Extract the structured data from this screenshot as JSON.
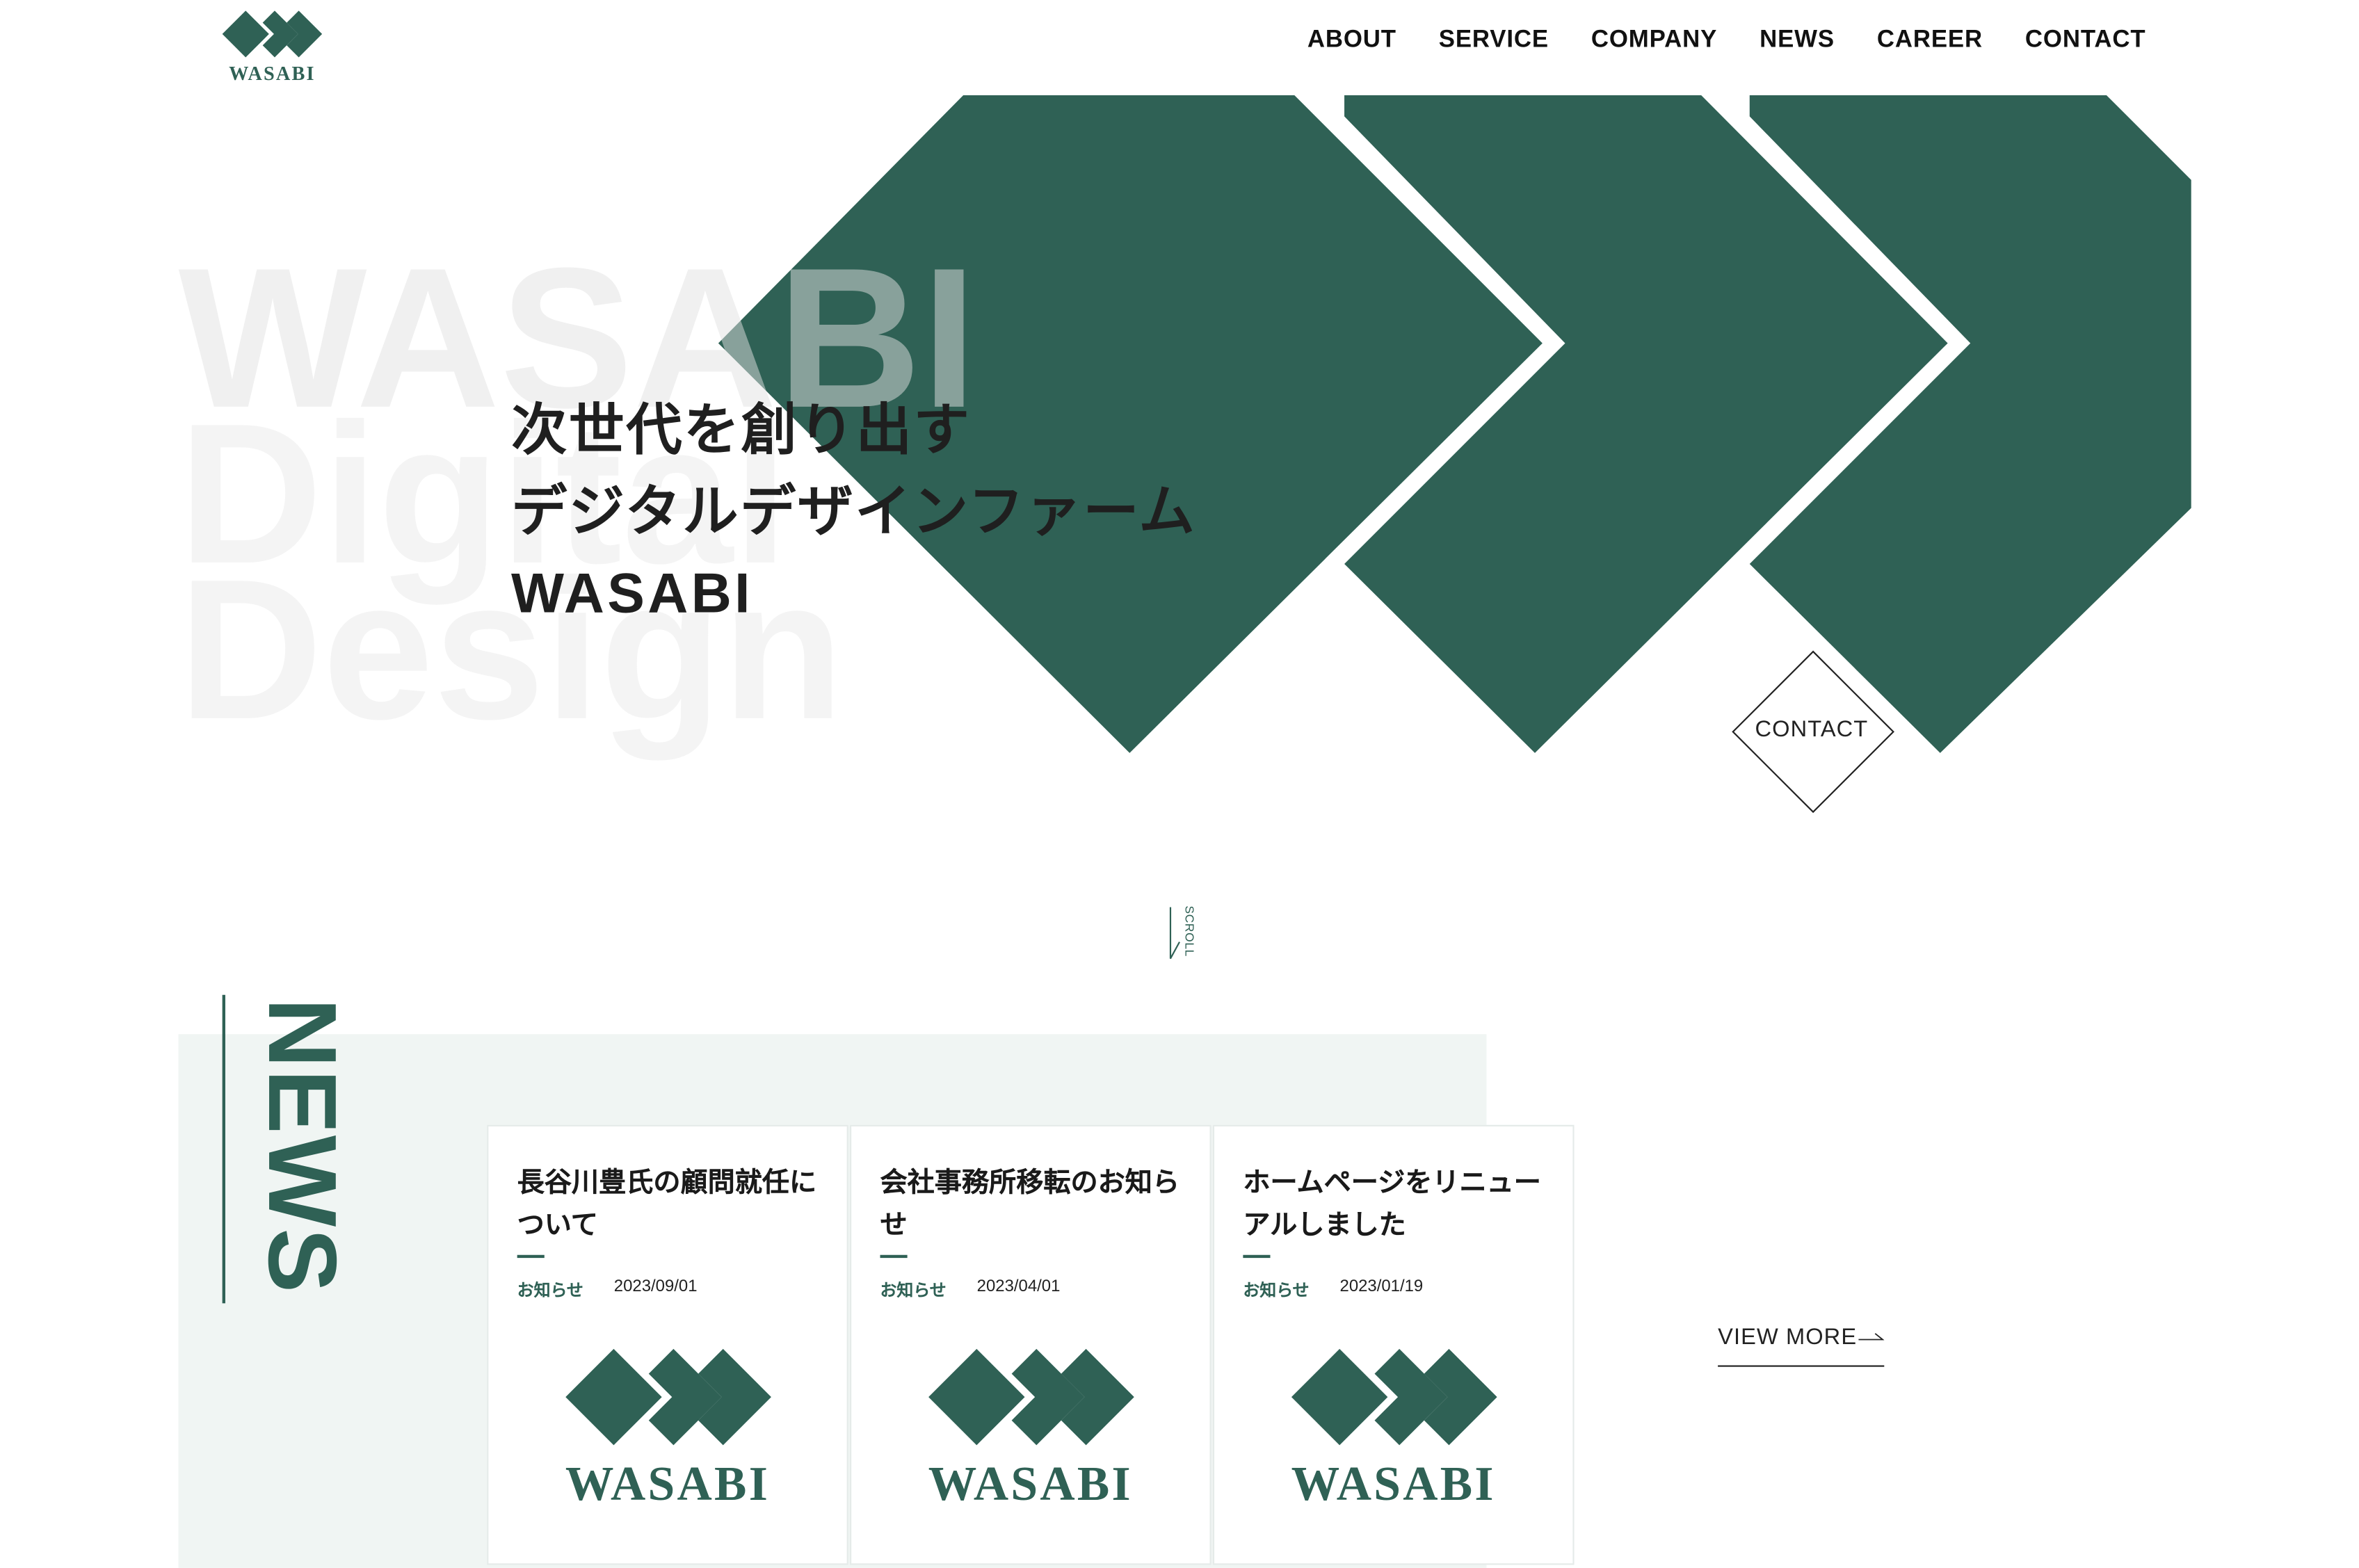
{
  "header": {
    "logo_text": "WASABI",
    "nav": [
      "ABOUT",
      "SERVICE",
      "COMPANY",
      "NEWS",
      "CAREER",
      "CONTACT"
    ]
  },
  "hero": {
    "background_text": [
      "WASABI",
      "Digital",
      "Design"
    ],
    "headline": [
      "次世代を創り出す",
      "デジタルデザインファーム",
      "WASABI"
    ],
    "contact_label": "CONTACT",
    "scroll_label": "SCROLL"
  },
  "news": {
    "title": "NEWS",
    "items": [
      {
        "title": "長谷川豊氏の顧問就任について",
        "category": "お知らせ",
        "date": "2023/09/01",
        "thumb_text": "WASABI"
      },
      {
        "title": "会社事務所移転のお知らせ",
        "category": "お知らせ",
        "date": "2023/04/01",
        "thumb_text": "WASABI"
      },
      {
        "title": "ホームページをリニューアルしました",
        "category": "お知らせ",
        "date": "2023/01/19",
        "thumb_text": "WASABI"
      }
    ],
    "view_more": "VIEW MORE"
  },
  "colors": {
    "brand": "#2f6155",
    "news_bg": "#f0f5f3",
    "text": "#1f1f1f"
  }
}
